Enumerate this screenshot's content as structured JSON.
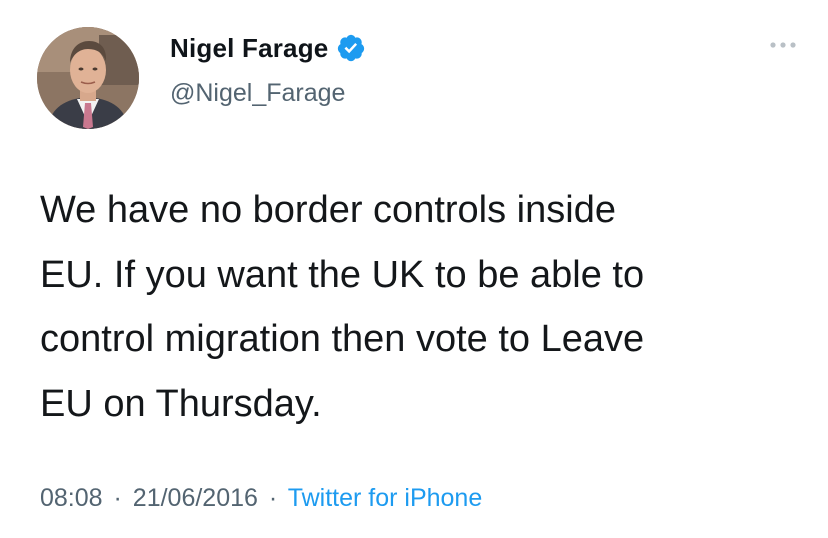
{
  "user": {
    "display_name": "Nigel Farage",
    "handle": "@Nigel_Farage",
    "verified": true
  },
  "tweet": {
    "text": "We have no border controls inside\nEU. If you want the UK to be able to\ncontrol migration then vote to Leave\nEU on Thursday.",
    "time": "08:08",
    "date": "21/06/2016",
    "separator": "·",
    "source": "Twitter for iPhone"
  },
  "colors": {
    "verified_badge": "#1d9bf0",
    "secondary_text": "#536471",
    "link": "#1d9bf0"
  },
  "icons": {
    "verified": "verified-badge-icon",
    "more": "more-options-icon"
  }
}
